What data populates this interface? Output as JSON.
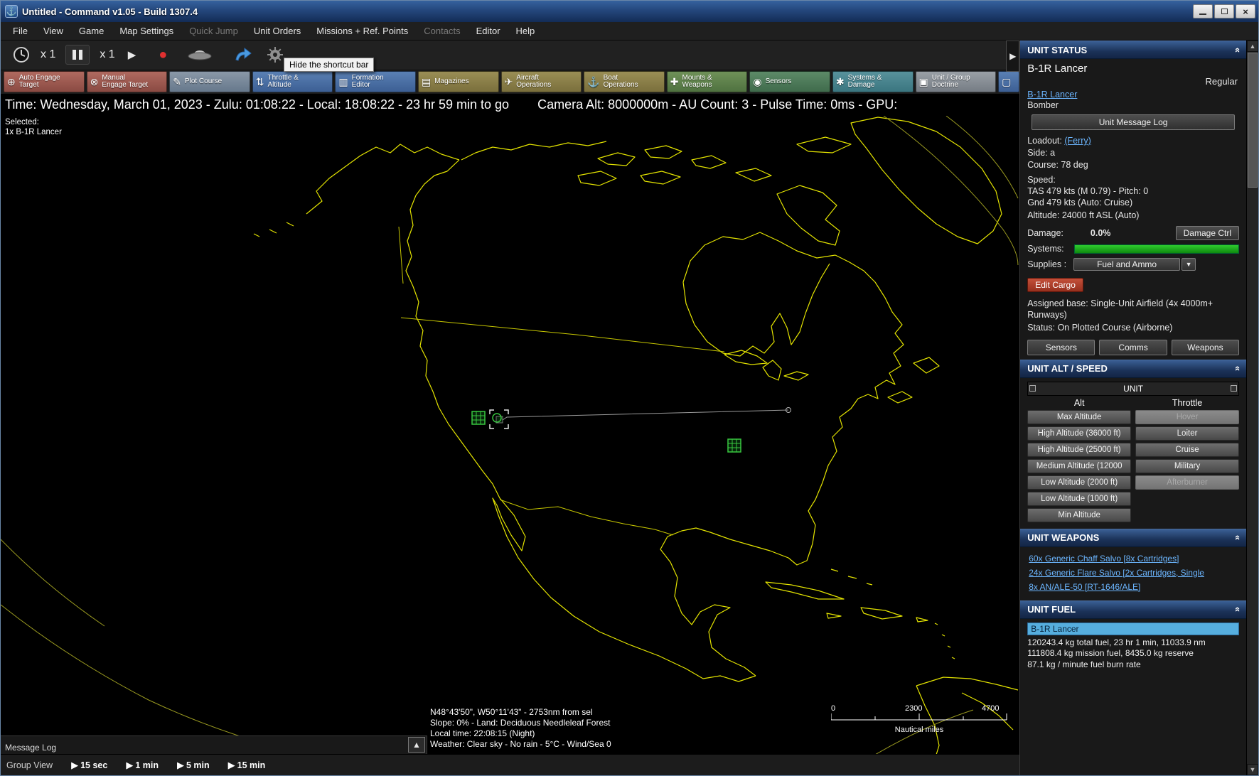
{
  "window": {
    "title": "Untitled - Command v1.05 - Build 1307.4"
  },
  "menu": {
    "items": [
      {
        "label": "File",
        "enabled": true
      },
      {
        "label": "View",
        "enabled": true
      },
      {
        "label": "Game",
        "enabled": true
      },
      {
        "label": "Map Settings",
        "enabled": true
      },
      {
        "label": "Quick Jump",
        "enabled": false
      },
      {
        "label": "Unit Orders",
        "enabled": true
      },
      {
        "label": "Missions + Ref. Points",
        "enabled": true
      },
      {
        "label": "Contacts",
        "enabled": false
      },
      {
        "label": "Editor",
        "enabled": true
      },
      {
        "label": "Help",
        "enabled": true
      }
    ]
  },
  "toolbar": {
    "speed_display": "x 1",
    "speed_display2": "x 1",
    "tooltip": "Hide the shortcut bar"
  },
  "shortcut_bar": {
    "buttons": [
      {
        "label": "Auto Engage\nTarget",
        "icon": "⊕",
        "color": "#9d5a52"
      },
      {
        "label": "Manual\nEngage Target",
        "icon": "⊗",
        "color": "#9d5a52"
      },
      {
        "label": "Plot Course",
        "icon": "✎",
        "color": "#66788c"
      },
      {
        "label": "Throttle &\nAltitude",
        "icon": "⇅",
        "color": "#3c5f94"
      },
      {
        "label": "Formation\nEditor",
        "icon": "▥",
        "color": "#3c5f94"
      },
      {
        "label": "Magazines",
        "icon": "▤",
        "color": "#7a6f3c"
      },
      {
        "label": "Aircraft\nOperations",
        "icon": "✈",
        "color": "#7a6f3c"
      },
      {
        "label": "Boat\nOperations",
        "icon": "⚓",
        "color": "#7a6f3c"
      },
      {
        "label": "Mounts &\nWeapons",
        "icon": "✚",
        "color": "#4f7240"
      },
      {
        "label": "Sensors",
        "icon": "◉",
        "color": "#3f6b4c"
      },
      {
        "label": "Systems &\nDamage",
        "icon": "✱",
        "color": "#3a7680"
      },
      {
        "label": "Unit / Group\nDoctrine",
        "icon": "▣",
        "color": "#757c84"
      }
    ]
  },
  "timebar": {
    "left": "Time: Wednesday, March 01, 2023 - Zulu: 01:08:22 - Local: 18:08:22 - 23 hr 59 min to go",
    "right": "Camera Alt: 8000000m - AU Count: 3 - Pulse Time: 0ms - GPU:"
  },
  "map": {
    "selected_label": "Selected:",
    "selected_unit": "1x B-1R Lancer",
    "info_lines": [
      "N48°43'50\", W50°11'43\" - 2753nm from sel",
      "Slope: 0% - Land: Deciduous Needleleaf Forest",
      "Local time: 22:08:15 (Night)",
      "Weather: Clear sky - No rain - 5°C - Wind/Sea 0"
    ],
    "scale_ticks": [
      "0",
      "2300",
      "4700"
    ],
    "scale_unit": "Nautical miles",
    "message_log": "Message Log"
  },
  "bottombar": {
    "group_view": "Group View",
    "time_buttons": [
      "15 sec",
      "1 min",
      "5 min",
      "15 min"
    ]
  },
  "sidebar": {
    "unit_status": {
      "header": "UNIT STATUS",
      "unit_name": "B-1R Lancer",
      "proficiency": "Regular",
      "unit_link": "B-1R Lancer",
      "unit_type": "Bomber",
      "message_log_button": "Unit Message Log",
      "loadout_label": "Loadout:",
      "loadout_link": "(Ferry)",
      "side": "Side: a",
      "course": "Course: 78 deg",
      "speed_label": "Speed:",
      "speed_line1": "TAS 479 kts (M 0.79) - Pitch: 0",
      "speed_line2": "Gnd 479 kts (Auto: Cruise)",
      "altitude": "Altitude: 24000 ft ASL (Auto)",
      "damage_label": "Damage:",
      "damage_value": "0.0%",
      "damage_button": "Damage Ctrl",
      "systems_label": "Systems:",
      "supplies_label": "Supplies :",
      "supplies_value": "Fuel and Ammo",
      "edit_cargo_button": "Edit Cargo",
      "assigned_base": "Assigned base: Single-Unit Airfield (4x 4000m+ Runways)",
      "status": "Status: On Plotted Course (Airborne)",
      "buttons": [
        "Sensors",
        "Comms",
        "Weapons"
      ]
    },
    "unit_alt_speed": {
      "header": "UNIT ALT / SPEED",
      "unit_label": "UNIT",
      "col_alt": "Alt",
      "col_throttle": "Throttle",
      "alt_buttons": [
        "Max Altitude",
        "High Altitude (36000 ft)",
        "High Altitude (25000 ft)",
        "Medium Altitude (12000",
        "Low Altitude (2000 ft)",
        "Low Altitude (1000 ft)",
        "Min Altitude"
      ],
      "throttle_buttons": [
        {
          "label": "Hover",
          "enabled": false
        },
        {
          "label": "Loiter",
          "enabled": true
        },
        {
          "label": "Cruise",
          "enabled": true
        },
        {
          "label": "Military",
          "enabled": true
        },
        {
          "label": "Afterburner",
          "enabled": false
        }
      ]
    },
    "unit_weapons": {
      "header": "UNIT WEAPONS",
      "links": [
        "60x Generic Chaff Salvo [8x Cartridges]",
        "24x Generic Flare Salvo [2x Cartridges, Single",
        "8x AN/ALE-50 [RT-1646/ALE]"
      ]
    },
    "unit_fuel": {
      "header": "UNIT FUEL",
      "selected": "B-1R Lancer",
      "lines": [
        "120243.4 kg total fuel, 23 hr 1 min, 11033.9 nm",
        "111808.4 kg mission fuel, 8435.0 kg reserve",
        "87.1 kg / minute fuel burn rate"
      ]
    }
  },
  "icons": {
    "play": "▶",
    "record": "●",
    "panel_collapse": "«",
    "dropdown": "▼",
    "scroll_up": "▲",
    "scroll_down": "▼",
    "message_log_up": "▲",
    "sidebar_collapse": "▶",
    "time_step": "▶",
    "close": "×"
  },
  "colors": {
    "map_outline": "#e4e400",
    "unit_marker": "#38c840",
    "panel_header": "#1b3258",
    "link": "#6cb6ff",
    "edit_cargo": "#b5402e",
    "systems_ok": "#18b418",
    "fuel_selected": "#56aede",
    "record": "#e03030"
  }
}
